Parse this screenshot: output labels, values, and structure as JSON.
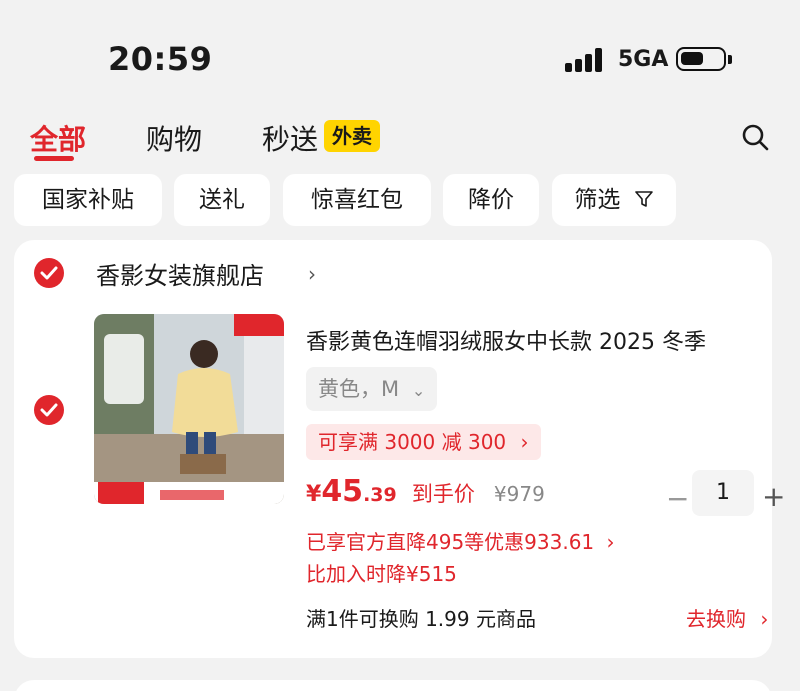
{
  "status_bar": {
    "time": "20:59",
    "network": "5GA"
  },
  "tabs": [
    {
      "label": "全部",
      "active": true
    },
    {
      "label": "购物",
      "active": false
    },
    {
      "label": "秒送",
      "active": false,
      "badge": "外卖"
    }
  ],
  "filters": [
    "国家补贴",
    "送礼",
    "惊喜红包",
    "降价",
    "筛选"
  ],
  "store": {
    "name": "香影女装旗舰店"
  },
  "product": {
    "title": "香影黄色连帽羽绒服女中长款 2025 冬季",
    "sku": "黄色，M",
    "promo": "可享满 3000 减 300",
    "price_symbol": "¥",
    "price_int": "45",
    "price_dec": ".39",
    "price_label": "到手价",
    "original_price": "¥979",
    "quantity": "1",
    "discount_text": "已享官方直降495等优惠933.61",
    "price_drop": "比加入时降¥515",
    "exchange_text": "满1件可换购 1.99 元商品",
    "exchange_link": "去换购"
  },
  "colors": {
    "accent": "#e0262c",
    "badge": "#ffd400",
    "background": "#f2f2f2"
  }
}
